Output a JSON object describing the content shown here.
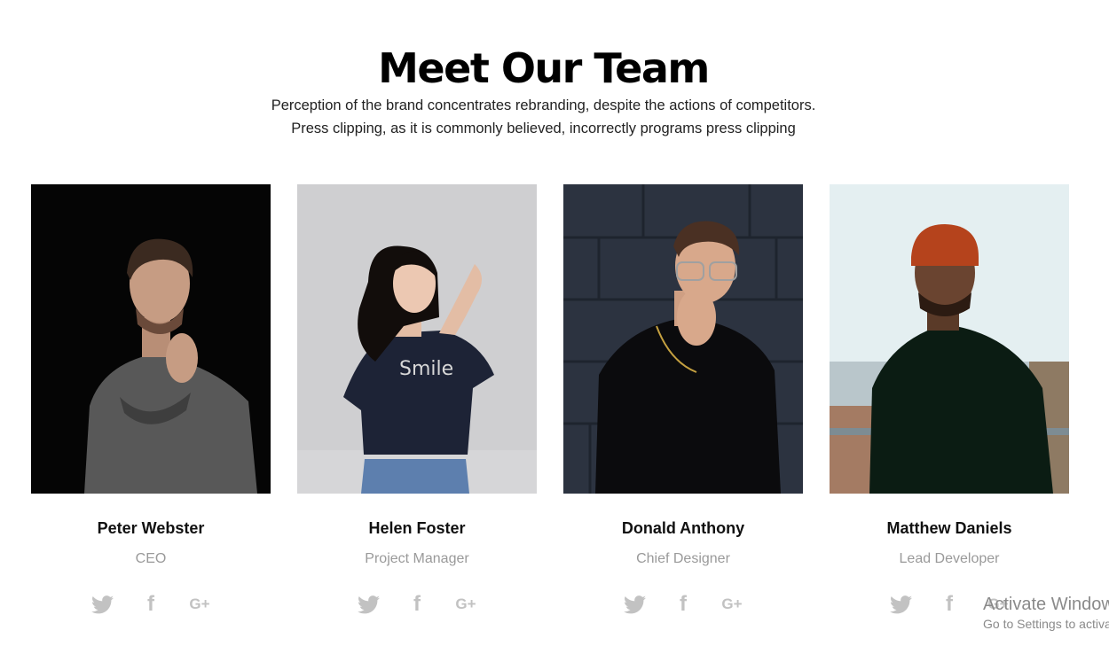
{
  "section": {
    "title": "Meet Our Team",
    "subtitle_line1": "Perception of the brand concentrates rebranding, despite the actions of competitors.",
    "subtitle_line2": "Press clipping, as it is commonly believed, incorrectly programs press clipping"
  },
  "team": [
    {
      "name": "Peter Webster",
      "role": "CEO"
    },
    {
      "name": "Helen Foster",
      "role": "Project Manager"
    },
    {
      "name": "Donald Anthony",
      "role": "Chief Designer"
    },
    {
      "name": "Matthew Daniels",
      "role": "Lead Developer"
    }
  ],
  "social": {
    "facebook_glyph": "f",
    "googleplus_glyph": "G+",
    "icons": [
      "twitter-icon",
      "facebook-icon",
      "google-plus-icon"
    ],
    "color": "#c2c2c2"
  },
  "watermark": {
    "line1": "Activate Windows",
    "line2": "Go to Settings to activate Windows."
  }
}
